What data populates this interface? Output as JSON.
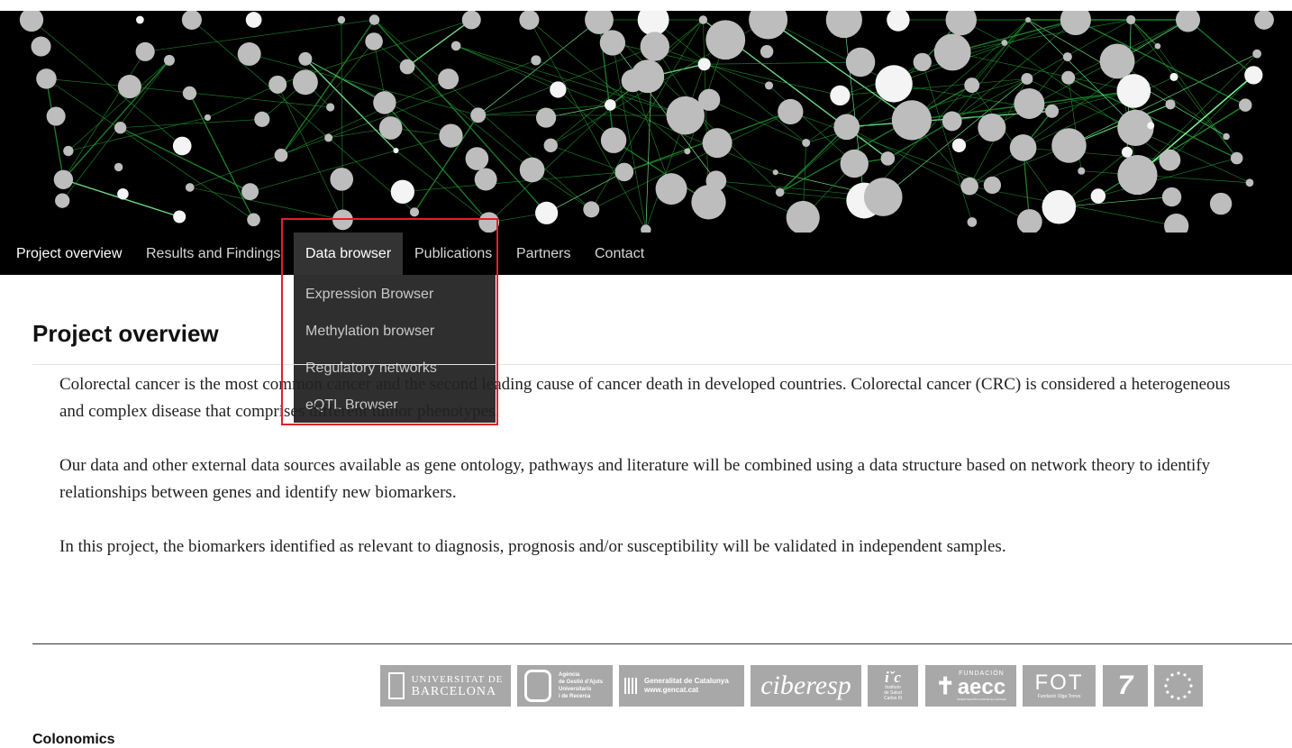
{
  "nav": {
    "items": [
      {
        "label": "Project overview"
      },
      {
        "label": "Results and Findings"
      },
      {
        "label": "Data browser"
      },
      {
        "label": "Publications"
      },
      {
        "label": "Partners"
      },
      {
        "label": "Contact"
      }
    ]
  },
  "dropdown": {
    "items": [
      {
        "label": "Expression Browser"
      },
      {
        "label": "Methylation browser"
      },
      {
        "label": "Regulatory networks"
      },
      {
        "label": "eQTL Browser"
      }
    ]
  },
  "content": {
    "title": "Project overview",
    "paragraphs": [
      "Colorectal cancer is the most common cancer and the second leading cause of cancer death in developed countries. Colorectal cancer (CRC) is considered a heterogeneous and complex disease that comprises different tumor phenotypes.",
      "Our data and other external data sources available as gene ontology, pathways and literature will be combined using a data structure based on network theory to identify relationships between genes and identify new biomarkers.",
      "In this project, the biomarkers identified as relevant to diagnosis, prognosis and/or susceptibility will be validated in independent samples."
    ]
  },
  "footer": {
    "logos": {
      "ub": [
        "UNIVERSITAT DE",
        "BARCELONA"
      ],
      "agaur": [
        "Agència",
        "de Gestió d'Ajuts",
        "Universitaris",
        "i de Recerca"
      ],
      "gencat": [
        "Generalitat de Catalunya",
        "www.gencat.cat"
      ],
      "ciberesp": "ciberesp",
      "isciii": [
        "Instituto",
        "de Salud",
        "Carlos III"
      ],
      "aecc": {
        "top": "FUNDACIÓN",
        "main": "aecc",
        "sub": "INVESTIGACIÓN CONTRA EL CÁNCER"
      },
      "fot": {
        "main": "FOT",
        "sub": "Fundació Olga Torres"
      }
    },
    "site_name": "Colonomics"
  },
  "colors": {
    "nav_bg": "#000000",
    "dropdown_bg": "#2f2f2f",
    "highlight": "#e0202a",
    "logo_bg": "#a8a8a8"
  }
}
